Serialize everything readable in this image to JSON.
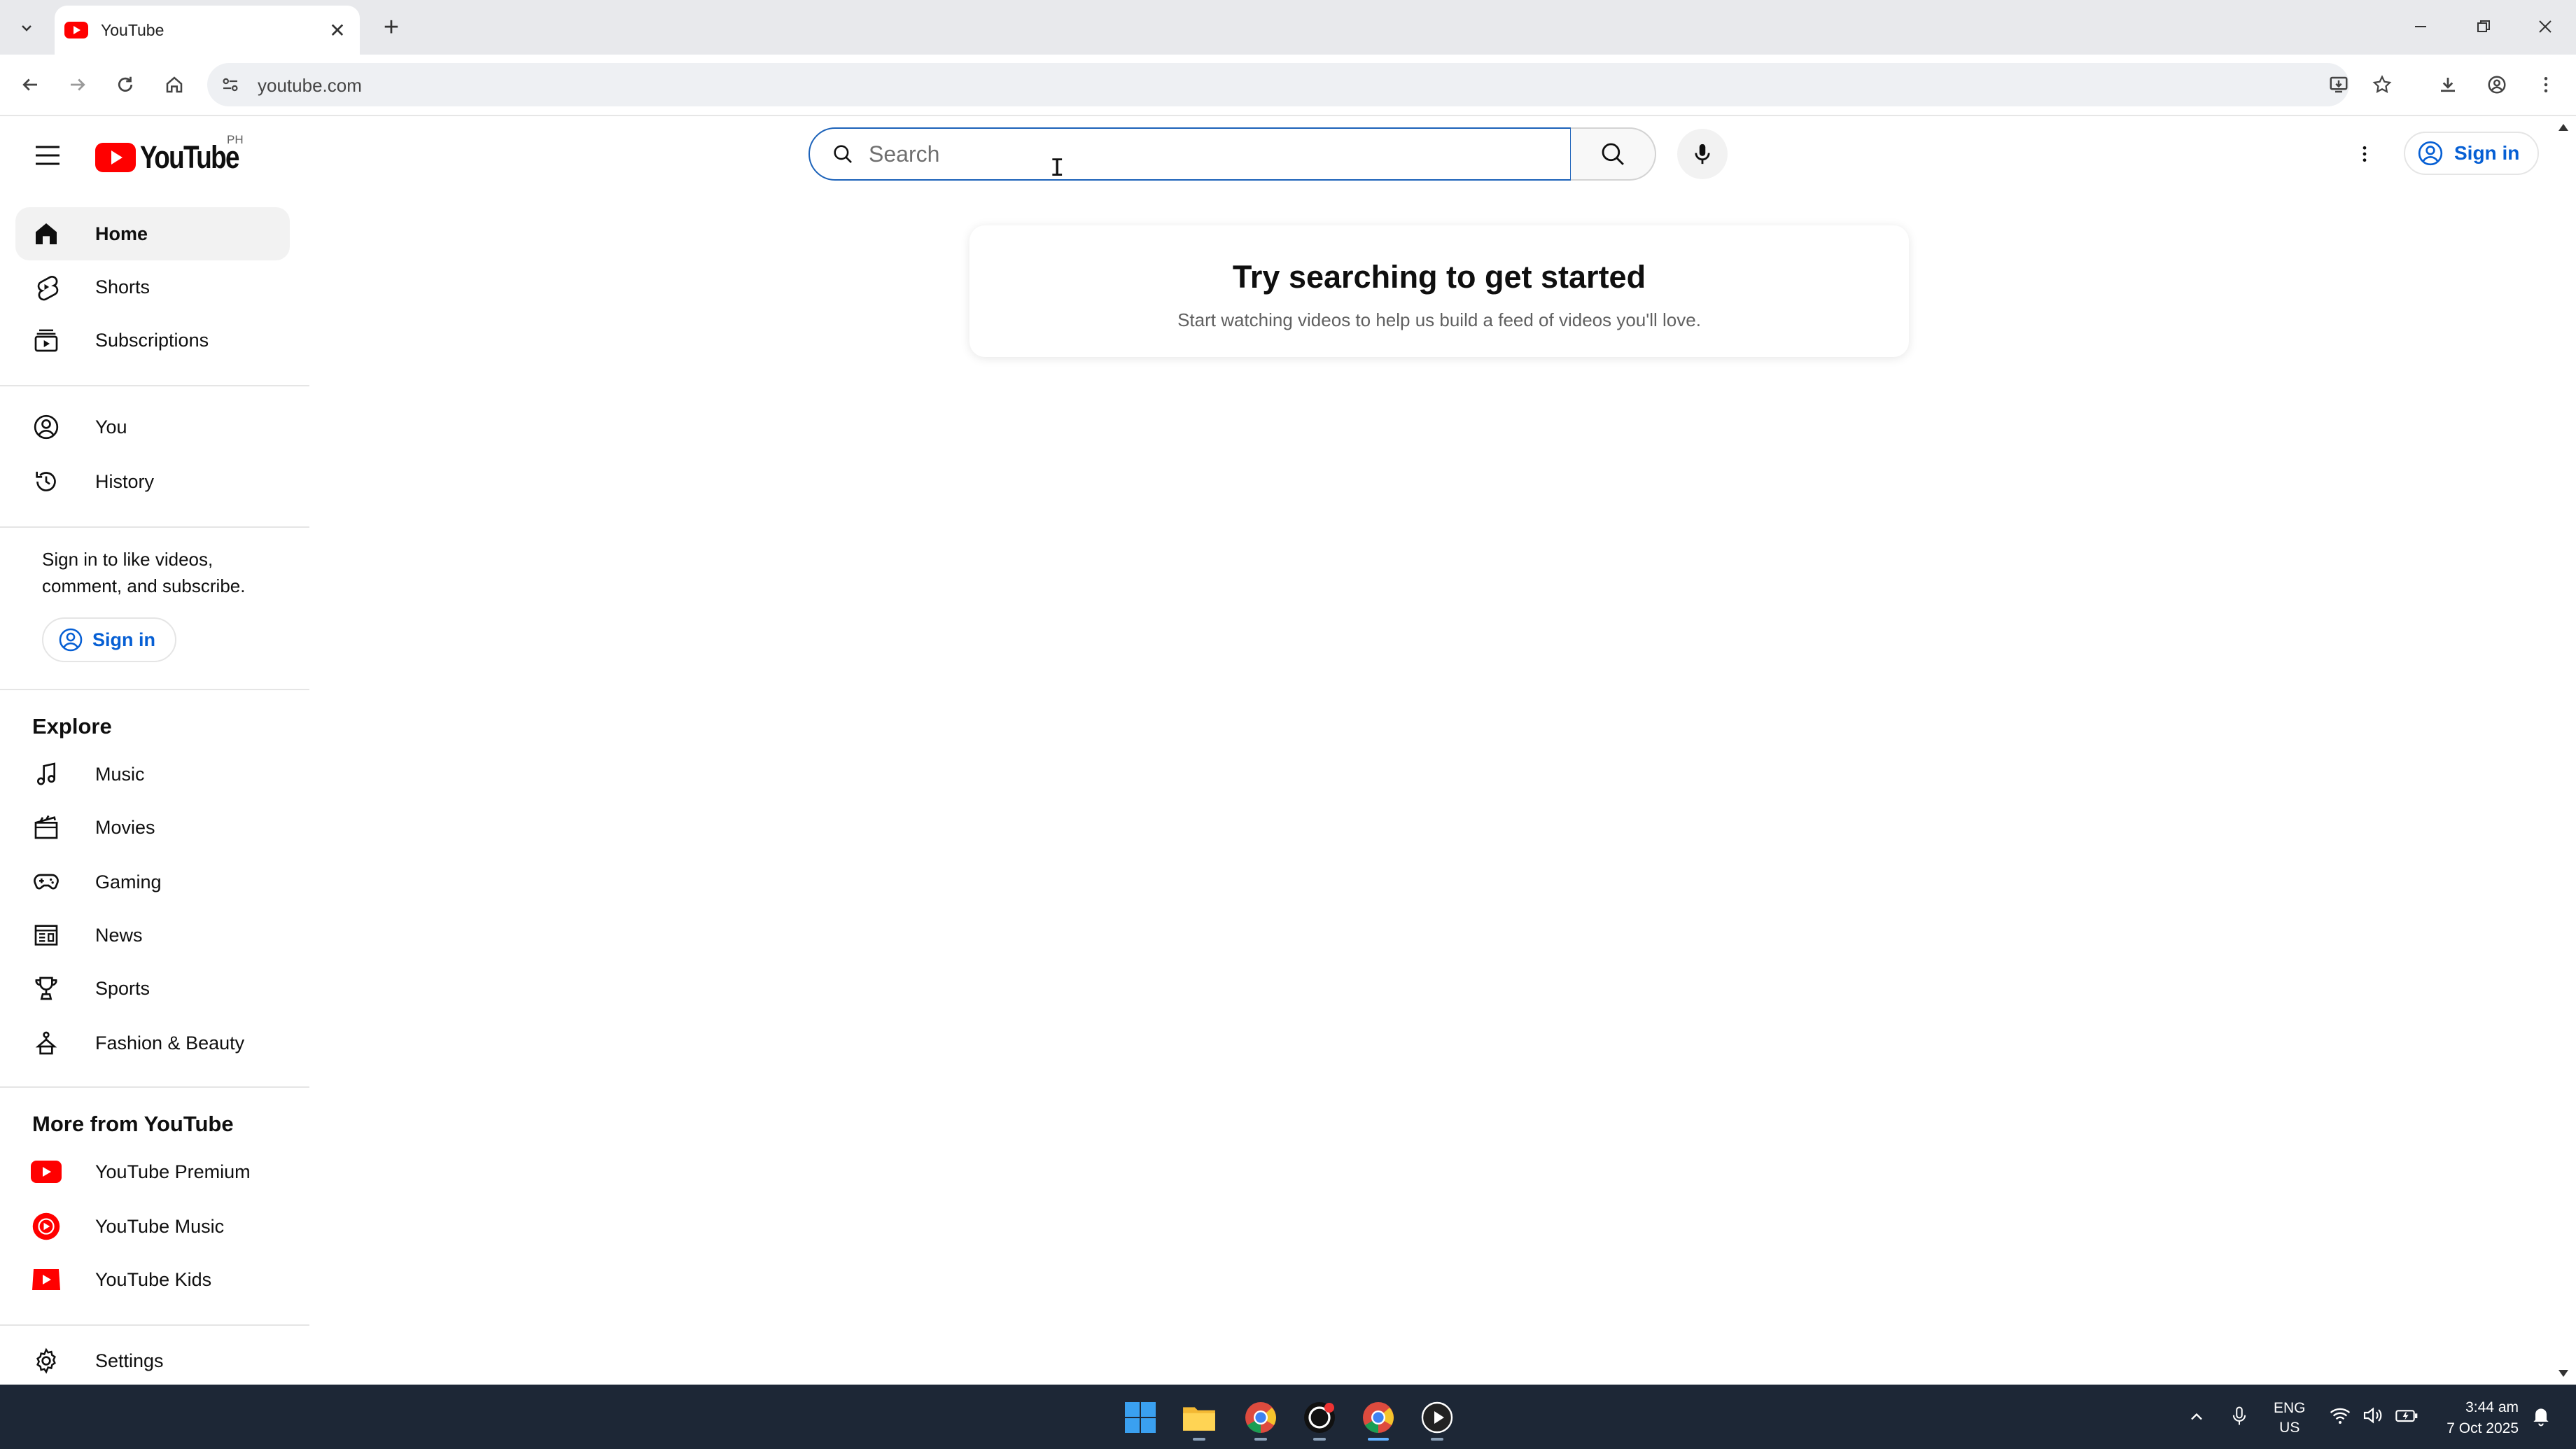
{
  "browser": {
    "tab_title": "YouTube",
    "url": "youtube.com"
  },
  "header": {
    "logo_text": "YouTube",
    "country_code": "PH",
    "search_placeholder": "Search",
    "search_value": "",
    "signin_label": "Sign in"
  },
  "sidebar": {
    "primary": [
      {
        "label": "Home",
        "icon": "home-icon"
      },
      {
        "label": "Shorts",
        "icon": "shorts-icon"
      },
      {
        "label": "Subscriptions",
        "icon": "subscriptions-icon"
      }
    ],
    "you": [
      {
        "label": "You",
        "icon": "you-icon"
      },
      {
        "label": "History",
        "icon": "history-icon"
      }
    ],
    "signin_prompt": "Sign in to like videos, comment, and subscribe.",
    "signin_label": "Sign in",
    "explore_heading": "Explore",
    "explore": [
      {
        "label": "Music",
        "icon": "music-icon"
      },
      {
        "label": "Movies",
        "icon": "movies-icon"
      },
      {
        "label": "Gaming",
        "icon": "gaming-icon"
      },
      {
        "label": "News",
        "icon": "news-icon"
      },
      {
        "label": "Sports",
        "icon": "sports-icon"
      },
      {
        "label": "Fashion & Beauty",
        "icon": "fashion-icon"
      }
    ],
    "more_heading": "More from YouTube",
    "more": [
      {
        "label": "YouTube Premium",
        "icon": "youtube-premium-icon"
      },
      {
        "label": "YouTube Music",
        "icon": "youtube-music-icon"
      },
      {
        "label": "YouTube Kids",
        "icon": "youtube-kids-icon"
      }
    ],
    "settings_label": "Settings"
  },
  "main": {
    "empty_title": "Try searching to get started",
    "empty_subtitle": "Start watching videos to help us build a feed of videos you'll love."
  },
  "taskbar": {
    "lang_top": "ENG",
    "lang_bottom": "US",
    "time": "3:44 am",
    "date": "7 Oct 2025"
  },
  "colors": {
    "brand_red": "#ff0000",
    "link_blue": "#065fd4",
    "search_focus": "#1c62b9",
    "taskbar_bg": "#1d2736"
  }
}
